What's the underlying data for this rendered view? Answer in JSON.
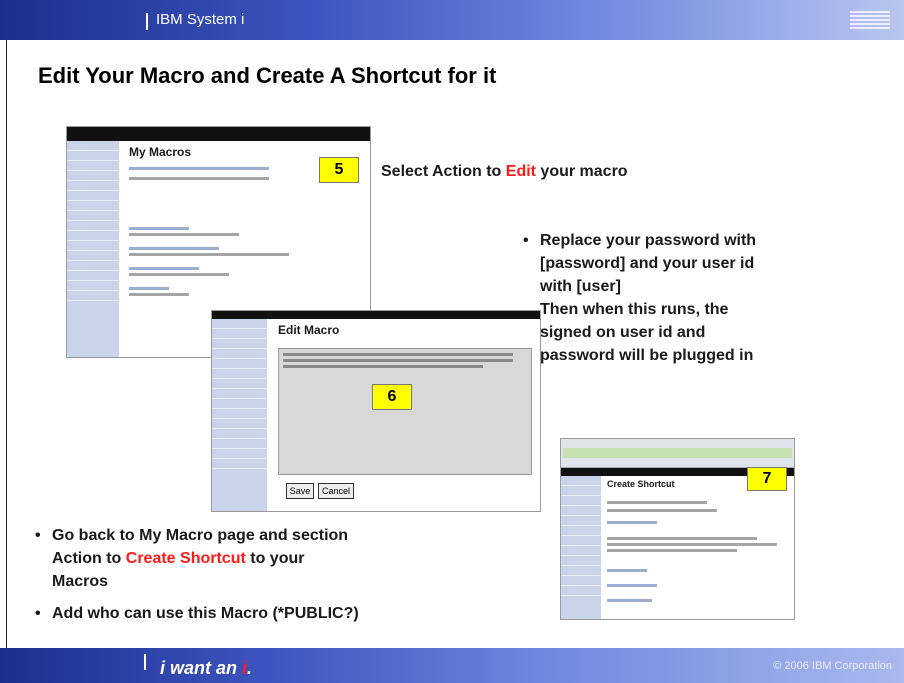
{
  "header": {
    "product": "IBM System i",
    "logo": "IBM"
  },
  "title": "Edit Your Macro and Create A Shortcut for it",
  "screenshots": {
    "my_macros": {
      "title": "My Macros",
      "step": "5"
    },
    "edit_macro": {
      "title": "Edit Macro",
      "step": "6",
      "save_label": "Save",
      "cancel_label": "Cancel"
    },
    "create_shortcut": {
      "title": "Create Shortcut",
      "step": "7"
    }
  },
  "step5": {
    "text_before": "Select Action to ",
    "text_highlight": "Edit",
    "text_after": " your macro"
  },
  "step6": {
    "bullet": "•",
    "lines": [
      "Replace your password with",
      "[password] and your user id",
      "with [user]",
      "Then when this runs, the",
      "signed on user id and",
      "password will be plugged in"
    ]
  },
  "step7": {
    "bullet": "•",
    "line1": "Go back to My Macro page and section",
    "line2_before": "Action to ",
    "line2_highlight": "Create Shortcut",
    "line2_after": " to your",
    "line3": "Macros",
    "line4": "Add who can use this Macro (*PUBLIC?)"
  },
  "footer": {
    "tagline_before": "i want an ",
    "tagline_i": "i",
    "tagline_dot": ".",
    "copyright": "© 2006 IBM Corporation"
  },
  "colors": {
    "highlight_red": "#ff1a1a",
    "badge_yellow": "#ffff00",
    "bar_blue": "#3d55c0"
  }
}
